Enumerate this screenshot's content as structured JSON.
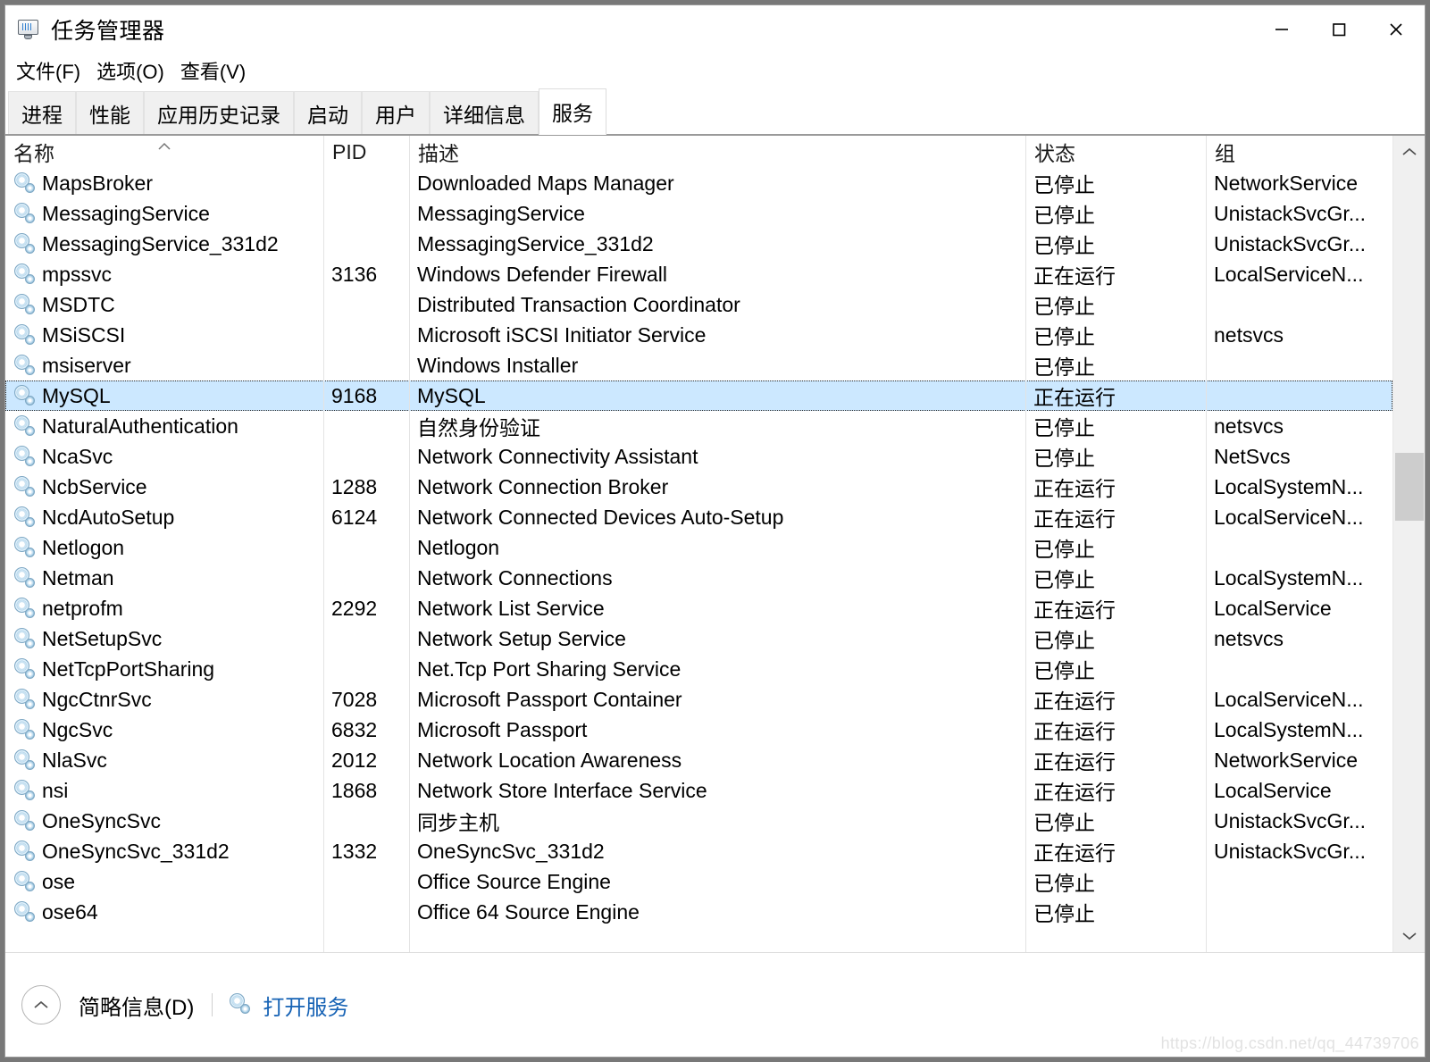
{
  "window": {
    "title": "任务管理器",
    "app_icon": "task-manager-icon",
    "controls": {
      "minimize": "—",
      "maximize": "□",
      "close": "✕"
    }
  },
  "menu": {
    "items": [
      {
        "label": "文件(F)"
      },
      {
        "label": "选项(O)"
      },
      {
        "label": "查看(V)"
      }
    ]
  },
  "tabs": [
    {
      "label": "进程",
      "active": false
    },
    {
      "label": "性能",
      "active": false
    },
    {
      "label": "应用历史记录",
      "active": false
    },
    {
      "label": "启动",
      "active": false
    },
    {
      "label": "用户",
      "active": false
    },
    {
      "label": "详细信息",
      "active": false
    },
    {
      "label": "服务",
      "active": true
    }
  ],
  "table": {
    "columns": [
      {
        "key": "name",
        "label": "名称",
        "sorted": "asc"
      },
      {
        "key": "pid",
        "label": "PID",
        "sorted": ""
      },
      {
        "key": "description",
        "label": "描述",
        "sorted": ""
      },
      {
        "key": "status",
        "label": "状态",
        "sorted": ""
      },
      {
        "key": "group",
        "label": "组",
        "sorted": ""
      }
    ],
    "rows": [
      {
        "icon": "service-gear-icon",
        "name": "MapsBroker",
        "pid": "",
        "description": "Downloaded Maps Manager",
        "status": "已停止",
        "group": "NetworkService",
        "selected": false
      },
      {
        "icon": "service-gear-icon",
        "name": "MessagingService",
        "pid": "",
        "description": "MessagingService",
        "status": "已停止",
        "group": "UnistackSvcGr...",
        "selected": false
      },
      {
        "icon": "service-gear-icon",
        "name": "MessagingService_331d2",
        "pid": "",
        "description": "MessagingService_331d2",
        "status": "已停止",
        "group": "UnistackSvcGr...",
        "selected": false
      },
      {
        "icon": "service-gear-icon",
        "name": "mpssvc",
        "pid": "3136",
        "description": "Windows Defender Firewall",
        "status": "正在运行",
        "group": "LocalServiceN...",
        "selected": false
      },
      {
        "icon": "service-gear-icon",
        "name": "MSDTC",
        "pid": "",
        "description": "Distributed Transaction Coordinator",
        "status": "已停止",
        "group": "",
        "selected": false
      },
      {
        "icon": "service-gear-icon",
        "name": "MSiSCSI",
        "pid": "",
        "description": "Microsoft iSCSI Initiator Service",
        "status": "已停止",
        "group": "netsvcs",
        "selected": false
      },
      {
        "icon": "service-gear-icon",
        "name": "msiserver",
        "pid": "",
        "description": "Windows Installer",
        "status": "已停止",
        "group": "",
        "selected": false
      },
      {
        "icon": "service-gear-icon",
        "name": "MySQL",
        "pid": "9168",
        "description": "MySQL",
        "status": "正在运行",
        "group": "",
        "selected": true
      },
      {
        "icon": "service-gear-icon",
        "name": "NaturalAuthentication",
        "pid": "",
        "description": "自然身份验证",
        "status": "已停止",
        "group": "netsvcs",
        "selected": false
      },
      {
        "icon": "service-gear-icon",
        "name": "NcaSvc",
        "pid": "",
        "description": "Network Connectivity Assistant",
        "status": "已停止",
        "group": "NetSvcs",
        "selected": false
      },
      {
        "icon": "service-gear-icon",
        "name": "NcbService",
        "pid": "1288",
        "description": "Network Connection Broker",
        "status": "正在运行",
        "group": "LocalSystemN...",
        "selected": false
      },
      {
        "icon": "service-gear-icon",
        "name": "NcdAutoSetup",
        "pid": "6124",
        "description": "Network Connected Devices Auto-Setup",
        "status": "正在运行",
        "group": "LocalServiceN...",
        "selected": false
      },
      {
        "icon": "service-gear-icon",
        "name": "Netlogon",
        "pid": "",
        "description": "Netlogon",
        "status": "已停止",
        "group": "",
        "selected": false
      },
      {
        "icon": "service-gear-icon",
        "name": "Netman",
        "pid": "",
        "description": "Network Connections",
        "status": "已停止",
        "group": "LocalSystemN...",
        "selected": false
      },
      {
        "icon": "service-gear-icon",
        "name": "netprofm",
        "pid": "2292",
        "description": "Network List Service",
        "status": "正在运行",
        "group": "LocalService",
        "selected": false
      },
      {
        "icon": "service-gear-icon",
        "name": "NetSetupSvc",
        "pid": "",
        "description": "Network Setup Service",
        "status": "已停止",
        "group": "netsvcs",
        "selected": false
      },
      {
        "icon": "service-gear-icon",
        "name": "NetTcpPortSharing",
        "pid": "",
        "description": "Net.Tcp Port Sharing Service",
        "status": "已停止",
        "group": "",
        "selected": false
      },
      {
        "icon": "service-gear-icon",
        "name": "NgcCtnrSvc",
        "pid": "7028",
        "description": "Microsoft Passport Container",
        "status": "正在运行",
        "group": "LocalServiceN...",
        "selected": false
      },
      {
        "icon": "service-gear-icon",
        "name": "NgcSvc",
        "pid": "6832",
        "description": "Microsoft Passport",
        "status": "正在运行",
        "group": "LocalSystemN...",
        "selected": false
      },
      {
        "icon": "service-gear-icon",
        "name": "NlaSvc",
        "pid": "2012",
        "description": "Network Location Awareness",
        "status": "正在运行",
        "group": "NetworkService",
        "selected": false
      },
      {
        "icon": "service-gear-icon",
        "name": "nsi",
        "pid": "1868",
        "description": "Network Store Interface Service",
        "status": "正在运行",
        "group": "LocalService",
        "selected": false
      },
      {
        "icon": "service-gear-icon",
        "name": "OneSyncSvc",
        "pid": "",
        "description": "同步主机",
        "status": "已停止",
        "group": "UnistackSvcGr...",
        "selected": false
      },
      {
        "icon": "service-gear-icon",
        "name": "OneSyncSvc_331d2",
        "pid": "1332",
        "description": "OneSyncSvc_331d2",
        "status": "正在运行",
        "group": "UnistackSvcGr...",
        "selected": false
      },
      {
        "icon": "service-gear-icon",
        "name": "ose",
        "pid": "",
        "description": "Office  Source Engine",
        "status": "已停止",
        "group": "",
        "selected": false
      },
      {
        "icon": "service-gear-icon",
        "name": "ose64",
        "pid": "",
        "description": "Office 64 Source Engine",
        "status": "已停止",
        "group": "",
        "selected": false
      }
    ]
  },
  "scrollbar": {
    "up_arrow_icon": "chevron-up-icon",
    "down_arrow_icon": "chevron-down-icon"
  },
  "bottom_bar": {
    "collapse_icon": "chevron-up-icon",
    "fewer_details_label": "简略信息(D)",
    "open_services_icon": "service-gear-icon",
    "open_services_label": "打开服务"
  },
  "watermark": "https://blog.csdn.net/qq_44739706",
  "colors": {
    "selection": "#cce8ff",
    "link": "#1763b5",
    "window_border": "#9a9a9a",
    "desktop": "#787878",
    "tab_inactive": "#f0f0f0",
    "scrollbar_track": "#f0f0f0",
    "scrollbar_thumb": "#cdcdcd"
  }
}
